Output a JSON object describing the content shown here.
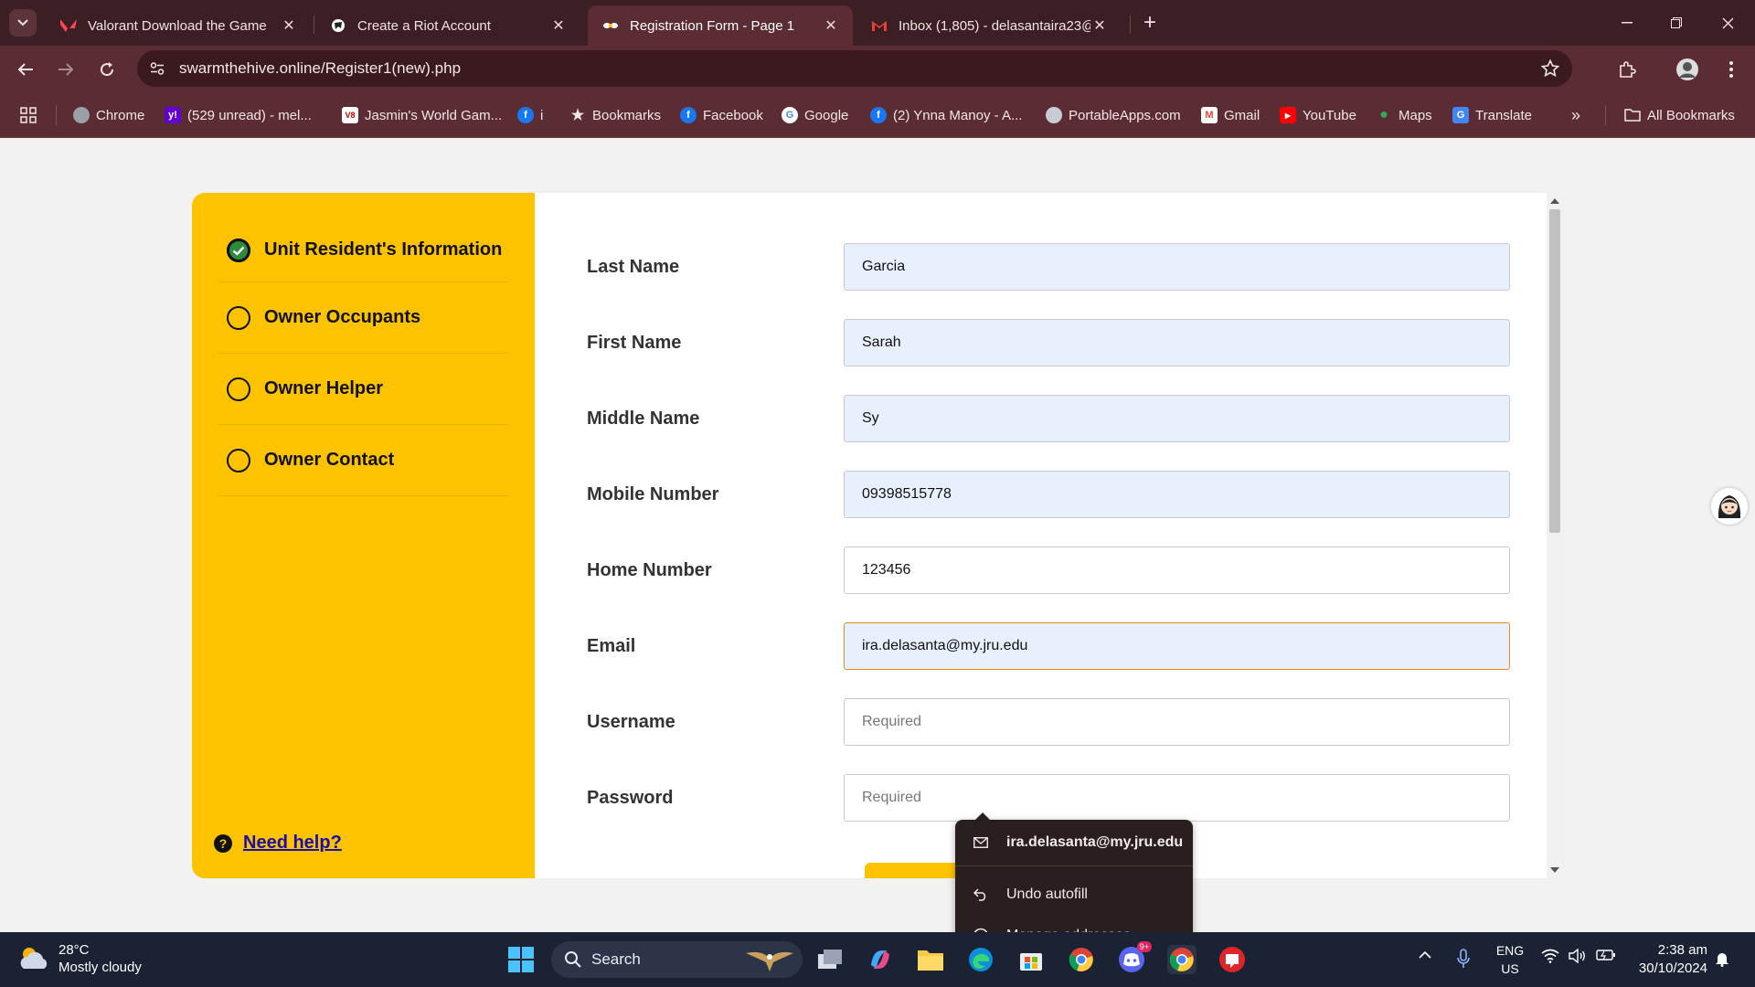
{
  "browser": {
    "tabs": [
      {
        "title": "Valorant Download the Game",
        "icon": "valorant-icon",
        "active": false
      },
      {
        "title": "Create a Riot Account",
        "icon": "riot-icon",
        "active": false
      },
      {
        "title": "Registration Form - Page 1",
        "icon": "swarm-icon",
        "active": true
      },
      {
        "title": "Inbox (1,805) - delasantaira23@",
        "icon": "gmail-icon",
        "active": false
      }
    ],
    "url": "swarmthehive.online/Register1(new).php",
    "bookmarks": [
      {
        "label": "Chrome",
        "icon": "chrome-icon"
      },
      {
        "label": "(529 unread) - mel...",
        "icon": "yahoo-icon"
      },
      {
        "label": "Jasmin's World Gam...",
        "icon": "game-icon"
      },
      {
        "label": "i",
        "icon": "facebook-icon"
      },
      {
        "label": "Bookmarks",
        "icon": "star-icon"
      },
      {
        "label": "Facebook",
        "icon": "facebook-icon"
      },
      {
        "label": "Google",
        "icon": "google-icon"
      },
      {
        "label": "(2) Ynna Manoy - A...",
        "icon": "facebook-icon"
      },
      {
        "label": "PortableApps.com",
        "icon": "portableapps-icon"
      },
      {
        "label": "Gmail",
        "icon": "gmail-icon"
      },
      {
        "label": "YouTube",
        "icon": "youtube-icon"
      },
      {
        "label": "Maps",
        "icon": "maps-icon"
      },
      {
        "label": "Translate",
        "icon": "translate-icon"
      }
    ],
    "all_bookmarks": "All Bookmarks"
  },
  "sidebar": {
    "steps": [
      {
        "label": "Unit Resident's Information",
        "done": true
      },
      {
        "label": "Owner Occupants",
        "done": false
      },
      {
        "label": "Owner Helper",
        "done": false
      },
      {
        "label": "Owner Contact",
        "done": false
      }
    ],
    "help": "Need help?"
  },
  "form": {
    "fields": [
      {
        "label": "Last Name",
        "value": "Garcia",
        "placeholder": "",
        "state": "autofill"
      },
      {
        "label": "First Name",
        "value": "Sarah",
        "placeholder": "",
        "state": "autofill"
      },
      {
        "label": "Middle Name",
        "value": "Sy",
        "placeholder": "",
        "state": "autofill"
      },
      {
        "label": "Mobile Number",
        "value": "09398515778",
        "placeholder": "",
        "state": "autofill"
      },
      {
        "label": "Home Number",
        "value": "123456",
        "placeholder": "",
        "state": "normal"
      },
      {
        "label": "Email",
        "value": "ira.delasanta@my.jru.edu",
        "placeholder": "",
        "state": "focused"
      },
      {
        "label": "Username",
        "value": "",
        "placeholder": "Required",
        "state": "normal"
      },
      {
        "label": "Password",
        "value": "",
        "placeholder": "Required",
        "state": "normal"
      }
    ]
  },
  "autofill_popup": {
    "suggestion": "ira.delasanta@my.jru.edu",
    "undo": "Undo autofill",
    "manage": "Manage addresses..."
  },
  "taskbar": {
    "temperature": "28°C",
    "weather": "Mostly cloudy",
    "search": "Search",
    "lang_top": "ENG",
    "lang_bottom": "US",
    "time": "2:38 am",
    "date": "30/10/2024",
    "discord_badge": "9+"
  },
  "colors": {
    "sidebar": "#fdc300",
    "tabbar": "#3c1f24",
    "toolbar": "#5b2c33",
    "focus_border": "#f08b1e",
    "autofill_bg": "#e8f0fe"
  }
}
